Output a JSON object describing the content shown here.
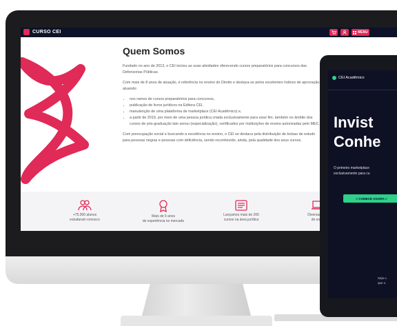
{
  "monitor": {
    "logo_text": "CURSO CEI",
    "menu_label": "MENU",
    "title": "Quem Somos",
    "para1": "Fundado no ano de 2013, o CEI iniciou as suas atividades oferecendo cursos preparatórios para concursos das Defensorias Públicas.",
    "para2": "Com mais de 8 anos de atuação, é referência no ensino do Direito e destaca-se pelos excelentes índices de aprovação, atuando:",
    "bullets": [
      "nos ramos de cursos preparatórios para concursos,",
      "publicação de livros jurídicos na Editora CEI,",
      "manutenção de uma plataforma de marketplace (CEI Acadêmico) e,",
      "a partir de 2019, por meio de uma pessoa jurídica criada exclusivamente para esse fim, também no âmbito dos cursos de pós-graduação lato sensu (especialização), certificados por instituições de ensino autorizadas pelo MEC."
    ],
    "para3": "Com preocupação social e buscando a excelência no ensino, o CEI se destaca pela distribuição de bolsas de estudo para pessoas negras e pessoas com deficiência, sendo reconhecido, ainda, pela qualidade dos seus cursos.",
    "stats": [
      {
        "line1": "+75.000 alunos",
        "line2": "estudaram conosco",
        "icon": "people-icon"
      },
      {
        "line1": "Mais de 9 anos",
        "line2": "de experiência no mercado",
        "icon": "award-icon"
      },
      {
        "line1": "Lançamos mais de 200",
        "line2": "cursos na área jurídica",
        "icon": "document-icon"
      },
      {
        "line1": "Diversas pla",
        "line2": "de estu",
        "icon": "laptop-icon"
      }
    ],
    "accent": "#e02a57",
    "navy": "#0c1228"
  },
  "laptop": {
    "brand": "CEI Acadêmico",
    "headline_line1": "Invist",
    "headline_line2": "Conhe",
    "sub_line1": "O primeiro marketplace",
    "sub_line2": "exclusivamente para cu",
    "button_label": "> COMECE AGORA <",
    "foot_line1": "Seja u",
    "foot_line2": "que o",
    "accent": "#2ed08a"
  }
}
